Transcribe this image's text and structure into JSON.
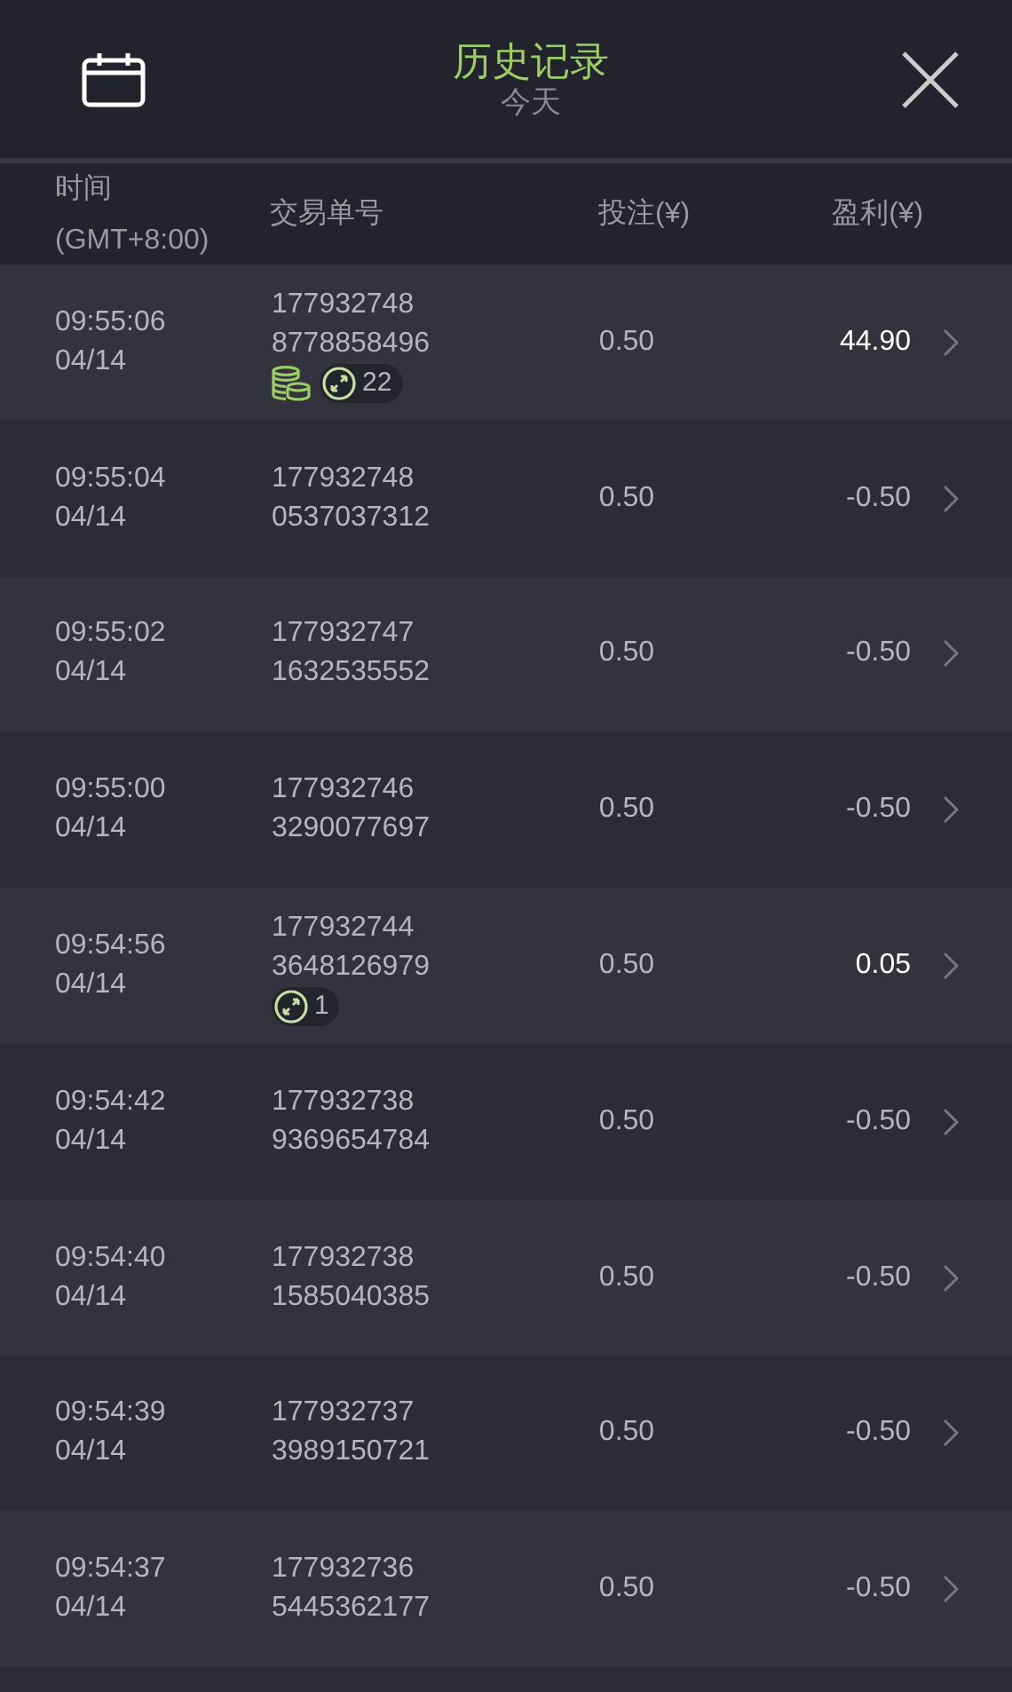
{
  "header": {
    "title": "历史记录",
    "subtitle": "今天"
  },
  "columns": {
    "time": [
      "时间",
      "(GMT+8:00)"
    ],
    "order": "交易单号",
    "stake": "投注(¥)",
    "profit": "盈利(¥)"
  },
  "rows": [
    {
      "time": "09:55:06",
      "date": "04/14",
      "order": [
        "177932748",
        "8778858496"
      ],
      "stake": "0.50",
      "profit": "44.90",
      "win": true,
      "coins": true,
      "badge": "22"
    },
    {
      "time": "09:55:04",
      "date": "04/14",
      "order": [
        "177932748",
        "0537037312"
      ],
      "stake": "0.50",
      "profit": "-0.50",
      "win": false
    },
    {
      "time": "09:55:02",
      "date": "04/14",
      "order": [
        "177932747",
        "1632535552"
      ],
      "stake": "0.50",
      "profit": "-0.50",
      "win": false
    },
    {
      "time": "09:55:00",
      "date": "04/14",
      "order": [
        "177932746",
        "3290077697"
      ],
      "stake": "0.50",
      "profit": "-0.50",
      "win": false
    },
    {
      "time": "09:54:56",
      "date": "04/14",
      "order": [
        "177932744",
        "3648126979"
      ],
      "stake": "0.50",
      "profit": "0.05",
      "win": true,
      "coins": false,
      "badge": "1"
    },
    {
      "time": "09:54:42",
      "date": "04/14",
      "order": [
        "177932738",
        "9369654784"
      ],
      "stake": "0.50",
      "profit": "-0.50",
      "win": false
    },
    {
      "time": "09:54:40",
      "date": "04/14",
      "order": [
        "177932738",
        "1585040385"
      ],
      "stake": "0.50",
      "profit": "-0.50",
      "win": false
    },
    {
      "time": "09:54:39",
      "date": "04/14",
      "order": [
        "177932737",
        "3989150721"
      ],
      "stake": "0.50",
      "profit": "-0.50",
      "win": false
    },
    {
      "time": "09:54:37",
      "date": "04/14",
      "order": [
        "177932736",
        "5445362177"
      ],
      "stake": "0.50",
      "profit": "-0.50",
      "win": false
    }
  ]
}
